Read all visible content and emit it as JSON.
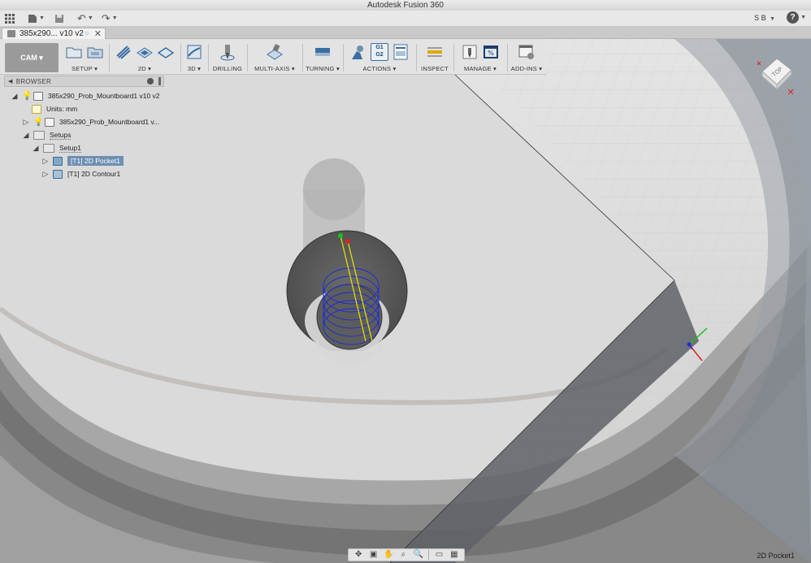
{
  "app": {
    "title": "Autodesk Fusion 360"
  },
  "quick_access": {
    "user": "S B",
    "help": "?"
  },
  "document_tab": {
    "label": "385x290... v10 v2"
  },
  "ribbon": {
    "workspace": "CAM",
    "groups": [
      {
        "id": "setup",
        "label": "SETUP",
        "has_dropdown": true
      },
      {
        "id": "2d",
        "label": "2D",
        "has_dropdown": true
      },
      {
        "id": "3d",
        "label": "3D",
        "has_dropdown": true
      },
      {
        "id": "drilling",
        "label": "DRILLING",
        "has_dropdown": false
      },
      {
        "id": "multi-axis",
        "label": "MULTI-AXIS",
        "has_dropdown": true
      },
      {
        "id": "turning",
        "label": "TURNING",
        "has_dropdown": true
      },
      {
        "id": "actions",
        "label": "ACTIONS",
        "has_dropdown": true
      },
      {
        "id": "inspect",
        "label": "INSPECT",
        "has_dropdown": false
      },
      {
        "id": "manage",
        "label": "MANAGE",
        "has_dropdown": true
      },
      {
        "id": "add-ins",
        "label": "ADD-INS",
        "has_dropdown": true
      }
    ],
    "actions_icon_text": [
      "G1",
      "G2"
    ]
  },
  "browser": {
    "title": "BROWSER",
    "root": "385x290_Prob_Mountboard1 v10 v2",
    "units": "Units: mm",
    "component": "385x290_Prob_Mountboard1 v...",
    "setups": "Setups",
    "setup1": "Setup1",
    "op1": "[T1] 2D Pocket1",
    "op2": "[T1] 2D Contour1"
  },
  "viewcube": {
    "face": "TOP"
  },
  "status": {
    "selection": "2D Pocket1"
  },
  "colors": {
    "selection": "#6d8fb2",
    "toolpath": "#1a2bd6",
    "tool_axis": "#e6e600",
    "start_point": "#18c018",
    "end_point": "#e02020"
  }
}
